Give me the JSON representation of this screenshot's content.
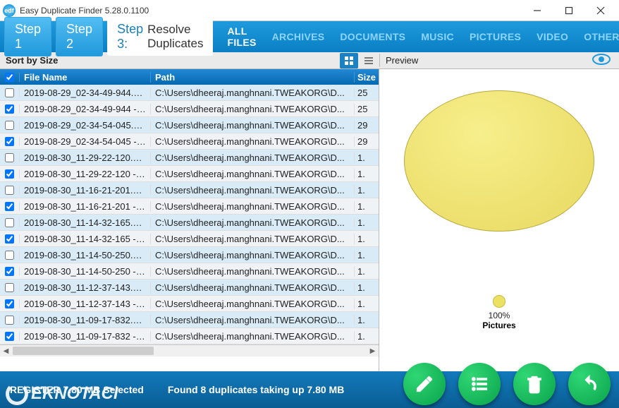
{
  "titlebar": {
    "title": "Easy Duplicate Finder 5.28.0.1100"
  },
  "steps": {
    "s1": "Step 1",
    "s2": "Step 2",
    "s3": "Step 3:",
    "s3sub": "Resolve Duplicates"
  },
  "filters": {
    "all": "ALL FILES",
    "archives": "ARCHIVES",
    "documents": "DOCUMENTS",
    "music": "MUSIC",
    "pictures": "PICTURES",
    "video": "VIDEO",
    "other": "OTHER"
  },
  "sort_label": "Sort by Size",
  "preview_label": "Preview",
  "columns": {
    "name": "File Name",
    "path": "Path",
    "size": "Size"
  },
  "rows": [
    {
      "checked": false,
      "orig": true,
      "name": "2019-08-29_02-34-49-944.png",
      "path": "C:\\Users\\dheeraj.manghnani.TWEAKORG\\D...",
      "size": "25"
    },
    {
      "checked": true,
      "orig": false,
      "name": "2019-08-29_02-34-49-944 - C...",
      "path": "C:\\Users\\dheeraj.manghnani.TWEAKORG\\D...",
      "size": "25"
    },
    {
      "checked": false,
      "orig": true,
      "name": "2019-08-29_02-34-54-045.png",
      "path": "C:\\Users\\dheeraj.manghnani.TWEAKORG\\D...",
      "size": "29"
    },
    {
      "checked": true,
      "orig": false,
      "name": "2019-08-29_02-34-54-045 - C...",
      "path": "C:\\Users\\dheeraj.manghnani.TWEAKORG\\D...",
      "size": "29"
    },
    {
      "checked": false,
      "orig": true,
      "name": "2019-08-30_11-29-22-120.png",
      "path": "C:\\Users\\dheeraj.manghnani.TWEAKORG\\D...",
      "size": "1."
    },
    {
      "checked": true,
      "orig": false,
      "name": "2019-08-30_11-29-22-120 - C...",
      "path": "C:\\Users\\dheeraj.manghnani.TWEAKORG\\D...",
      "size": "1."
    },
    {
      "checked": false,
      "orig": true,
      "name": "2019-08-30_11-16-21-201.png",
      "path": "C:\\Users\\dheeraj.manghnani.TWEAKORG\\D...",
      "size": "1."
    },
    {
      "checked": true,
      "orig": false,
      "name": "2019-08-30_11-16-21-201 - C...",
      "path": "C:\\Users\\dheeraj.manghnani.TWEAKORG\\D...",
      "size": "1."
    },
    {
      "checked": false,
      "orig": true,
      "name": "2019-08-30_11-14-32-165.png",
      "path": "C:\\Users\\dheeraj.manghnani.TWEAKORG\\D...",
      "size": "1."
    },
    {
      "checked": true,
      "orig": false,
      "name": "2019-08-30_11-14-32-165 - C...",
      "path": "C:\\Users\\dheeraj.manghnani.TWEAKORG\\D...",
      "size": "1."
    },
    {
      "checked": false,
      "orig": true,
      "name": "2019-08-30_11-14-50-250.png",
      "path": "C:\\Users\\dheeraj.manghnani.TWEAKORG\\D...",
      "size": "1."
    },
    {
      "checked": true,
      "orig": false,
      "name": "2019-08-30_11-14-50-250 - C...",
      "path": "C:\\Users\\dheeraj.manghnani.TWEAKORG\\D...",
      "size": "1."
    },
    {
      "checked": false,
      "orig": true,
      "name": "2019-08-30_11-12-37-143.png",
      "path": "C:\\Users\\dheeraj.manghnani.TWEAKORG\\D...",
      "size": "1."
    },
    {
      "checked": true,
      "orig": false,
      "name": "2019-08-30_11-12-37-143 - C...",
      "path": "C:\\Users\\dheeraj.manghnani.TWEAKORG\\D...",
      "size": "1."
    },
    {
      "checked": false,
      "orig": true,
      "name": "2019-08-30_11-09-17-832.png",
      "path": "C:\\Users\\dheeraj.manghnani.TWEAKORG\\D...",
      "size": "1."
    },
    {
      "checked": true,
      "orig": false,
      "name": "2019-08-30_11-09-17-832 - C...",
      "path": "C:\\Users\\dheeraj.manghnani.TWEAKORG\\D...",
      "size": "1."
    }
  ],
  "chart_data": {
    "type": "pie",
    "title": "",
    "slices": [
      {
        "label": "Pictures",
        "value": 100,
        "color": "#ece162"
      }
    ]
  },
  "legend": {
    "pct": "100%",
    "category": "Pictures"
  },
  "status": {
    "register": "REGISTER   7.80 MB Selected",
    "found": "Found 8 duplicates taking up 7.80 MB"
  },
  "watermark": "EKNOTACI"
}
